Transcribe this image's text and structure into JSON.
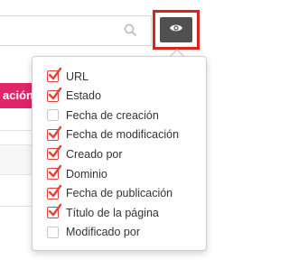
{
  "toolbar": {
    "search_icon": "search-icon",
    "view_button_icon": "eye-icon",
    "accent_color": "#d9241c"
  },
  "background": {
    "action_label": "ación",
    "action_color": "#e0256a"
  },
  "column_menu": {
    "items": [
      {
        "label": "URL",
        "checked": true
      },
      {
        "label": "Estado",
        "checked": true
      },
      {
        "label": "Fecha de creación",
        "checked": false
      },
      {
        "label": "Fecha de modificación",
        "checked": true
      },
      {
        "label": "Creado por",
        "checked": true
      },
      {
        "label": "Dominio",
        "checked": true
      },
      {
        "label": "Fecha de publicación",
        "checked": true
      },
      {
        "label": "Título de la página",
        "checked": true
      },
      {
        "label": "Modificado por",
        "checked": false
      }
    ],
    "check_color": "#e2423a"
  }
}
